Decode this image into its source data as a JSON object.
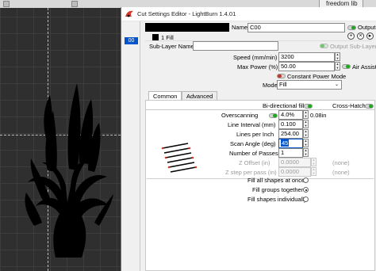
{
  "external_tab": {
    "label": "freedom lib"
  },
  "dialog": {
    "title": "Cut Settings Editor - LightBurn 1.4.01",
    "layer_strip": {
      "selected_layer": "00"
    },
    "name": {
      "label": "Name",
      "value": "C00"
    },
    "output": {
      "label": "Output",
      "on": true
    },
    "sub_layer_chip": {
      "label": "1 Fill"
    },
    "sub_layer_name": {
      "label": "Sub-Layer Name",
      "value": ""
    },
    "output_sub_layer": {
      "label": "Output Sub-Layer",
      "on": false
    },
    "buttons": {
      "add": "+",
      "remove": "×",
      "more": "▸"
    },
    "speed": {
      "label": "Speed (mm/min)",
      "value": "3200"
    },
    "max_power": {
      "label": "Max Power (%)",
      "value": "50.00"
    },
    "air_assist": {
      "label": "Air Assist",
      "on": true
    },
    "constant_power": {
      "label": "Constant Power Mode",
      "on": false
    },
    "mode": {
      "label": "Mode",
      "value": "Fill"
    },
    "tabs": [
      {
        "label": "Common"
      },
      {
        "label": "Advanced"
      }
    ],
    "bidirectional": {
      "label": "Bi-directional fill",
      "on": true
    },
    "crosshatch": {
      "label": "Cross-Hatch",
      "on": true
    },
    "overscanning": {
      "label": "Overscanning",
      "value": "4.0%",
      "unit_text": "0.08in",
      "on": true
    },
    "line_interval": {
      "label": "Line Interval (mm)",
      "value": "0.100"
    },
    "lines_per_inch": {
      "label": "Lines per Inch",
      "value": "254.00"
    },
    "scan_angle": {
      "label": "Scan Angle (deg)",
      "value": "45"
    },
    "num_passes": {
      "label": "Number of Passes",
      "value": "1"
    },
    "z_offset": {
      "label": "Z Offset (in)",
      "value": "0.0000",
      "note": "(none)"
    },
    "z_step": {
      "label": "Z step per pass (in)",
      "value": "0.0000",
      "note": "(none)"
    },
    "fill_options": [
      {
        "label": "Fill all shapes at once",
        "selected": false
      },
      {
        "label": "Fill groups together",
        "selected": true
      },
      {
        "label": "Fill shapes individually",
        "selected": false
      }
    ],
    "colors": {
      "layer_swatch": "#000000",
      "toggle_on": "#1ea81e",
      "toggle_off": "#c0392b",
      "selection": "#0055cc"
    }
  }
}
